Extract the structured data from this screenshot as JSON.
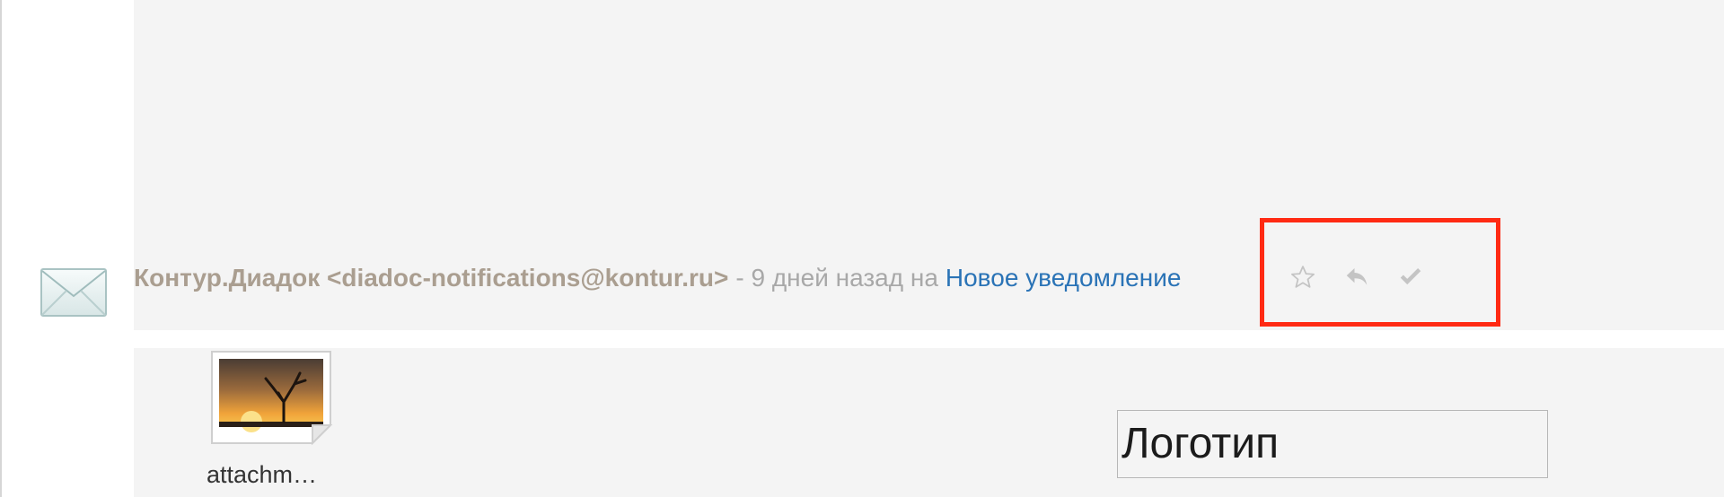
{
  "message": {
    "sender": "Контур.Диадок <diadoc-notifications@kontur.ru>",
    "meta": "- 9 дней назад на",
    "subject_link": "Новое уведомление"
  },
  "actions": [
    {
      "name": "star-icon",
      "label": "star"
    },
    {
      "name": "reply-icon",
      "label": "reply"
    },
    {
      "name": "checkmark-icon",
      "label": "mark done"
    }
  ],
  "attachment": {
    "name": "attachm…",
    "icon": "image-file-icon"
  },
  "logo_placeholder": "Логотип",
  "colors": {
    "panel_bg": "#f4f4f4",
    "sender": "#aa9e90",
    "link": "#2a73b6",
    "highlight": "#ff2a13",
    "icon_grey": "#c4c4c4"
  }
}
